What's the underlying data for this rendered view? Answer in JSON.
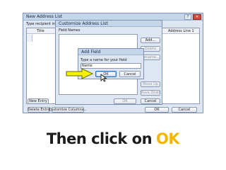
{
  "back_window": {
    "title": "New Address List",
    "instruction": "Type recipient info",
    "column_title": "Title",
    "column_address": "Address Line 1",
    "buttons": {
      "new_entry": "New Entry",
      "delete_entry": "Delete Entry",
      "customize_columns": "Customize Columns...",
      "ok": "OK",
      "cancel": "Cancel"
    }
  },
  "customize_dialog": {
    "title": "Customize Address List",
    "field_names_label": "Field Names",
    "buttons": {
      "add": "Add...",
      "delete": "Delete",
      "rename": "Rename...",
      "move_up": "Move Up",
      "move_down": "Move Down",
      "ok": "OK",
      "cancel": "Cancel"
    }
  },
  "add_field_dialog": {
    "title": "Add Field",
    "prompt": "Type a name for your field",
    "input_value": "Name",
    "ok": "OK",
    "cancel": "Cancel"
  },
  "caption": {
    "text_before": "Then click on",
    "text_highlight": "OK"
  },
  "colors": {
    "caption": "#1b1b1b",
    "highlight": "#f2b600",
    "arrow": "#f5f200"
  }
}
